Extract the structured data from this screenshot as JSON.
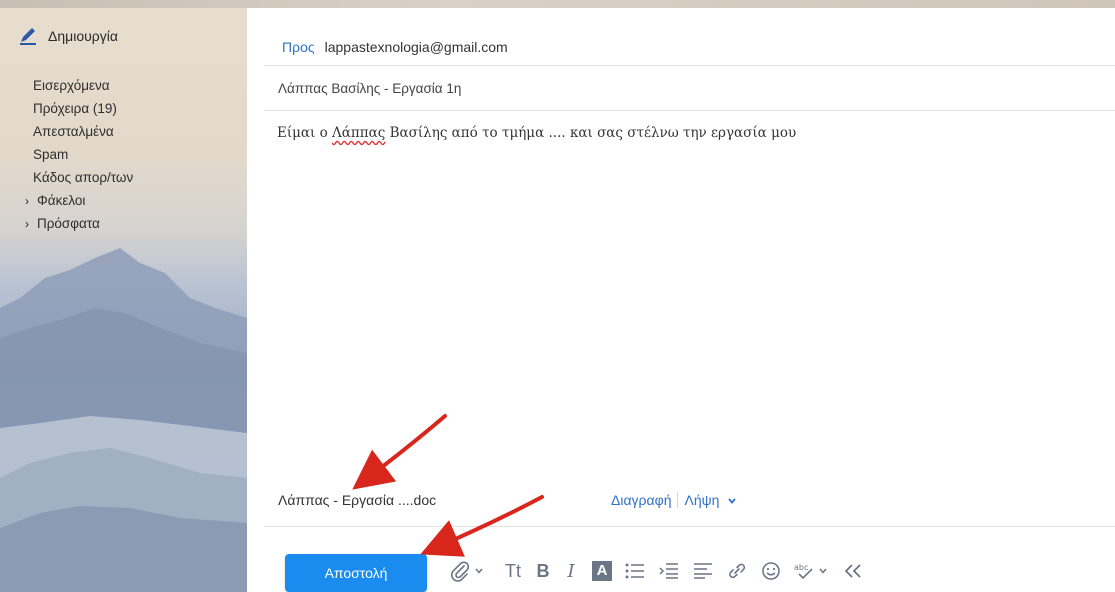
{
  "sidebar": {
    "compose_label": "Δημιουργία",
    "folders": [
      {
        "label": "Εισερχόμενα"
      },
      {
        "label": "Πρόχειρα (19)"
      },
      {
        "label": "Απεσταλμένα"
      },
      {
        "label": "Spam"
      },
      {
        "label": "Κάδος απορ/των"
      },
      {
        "label": "Φάκελοι"
      },
      {
        "label": "Πρόσφατα"
      }
    ]
  },
  "compose": {
    "to_label": "Προς",
    "to_value": "lappastexnologia@gmail.com",
    "subject": "Λάππας Βασίλης - Εργασία 1η",
    "body_before": "Είμαι ο ",
    "body_misspelled": "Λάππας",
    "body_after": " Βασίλης από το τμήμα ....  και σας στέλνω την εργασία μου"
  },
  "attachment": {
    "name": "Λάππας - Εργασία ....doc",
    "delete_label": "Διαγραφή",
    "download_label": "Λήψη"
  },
  "toolbar": {
    "send_label": "Αποστολή",
    "font_size_label": "Tt",
    "bold_label": "B",
    "italic_label": "I",
    "color_label": "A"
  },
  "colors": {
    "accent": "#1a8cf0",
    "link": "#2e73c7",
    "arrow": "#d9261c"
  }
}
